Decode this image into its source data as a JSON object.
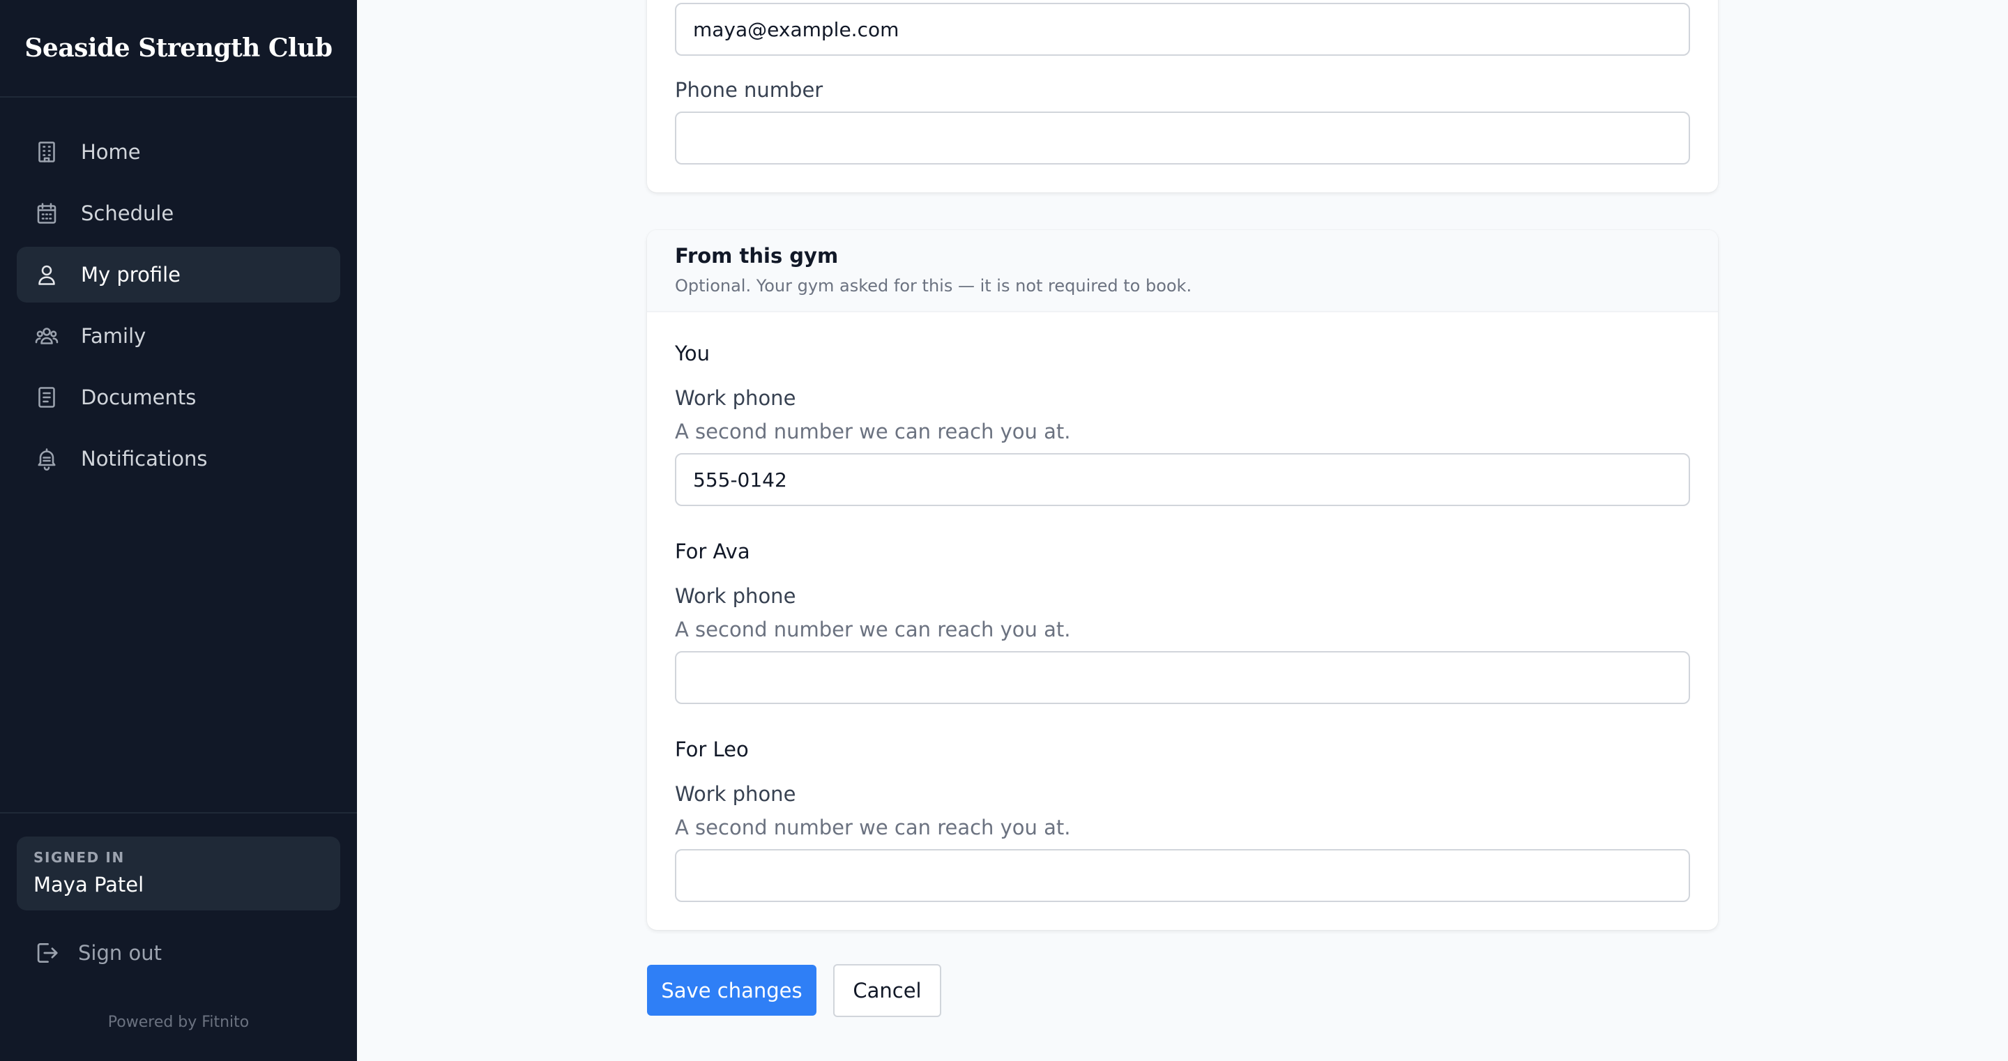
{
  "sidebar": {
    "brand": "Seaside Strength Club",
    "items": [
      {
        "label": "Home",
        "icon": "building-icon"
      },
      {
        "label": "Schedule",
        "icon": "calendar-icon"
      },
      {
        "label": "My profile",
        "icon": "user-icon",
        "active": true
      },
      {
        "label": "Family",
        "icon": "users-icon"
      },
      {
        "label": "Documents",
        "icon": "document-icon"
      },
      {
        "label": "Notifications",
        "icon": "bell-icon"
      }
    ],
    "signed_in_label": "SIGNED IN",
    "signed_in_name": "Maya Patel",
    "sign_out": "Sign out",
    "powered_by": "Powered by Fitnito"
  },
  "contact": {
    "email_value": "maya@example.com",
    "phone_label": "Phone number",
    "phone_value": ""
  },
  "gym": {
    "title": "From this gym",
    "subtitle": "Optional. Your gym asked for this — it is not required to book.",
    "sections": [
      {
        "heading": "You",
        "field_label": "Work phone",
        "help": "A second number we can reach you at.",
        "value": "555-0142"
      },
      {
        "heading": "For Ava",
        "field_label": "Work phone",
        "help": "A second number we can reach you at.",
        "value": ""
      },
      {
        "heading": "For Leo",
        "field_label": "Work phone",
        "help": "A second number we can reach you at.",
        "value": ""
      }
    ]
  },
  "actions": {
    "save": "Save changes",
    "cancel": "Cancel"
  },
  "colors": {
    "sidebar_bg": "#111827",
    "active_item_bg": "#1f2937",
    "primary": "#2f7ff6",
    "page_bg": "#f8fafc"
  }
}
